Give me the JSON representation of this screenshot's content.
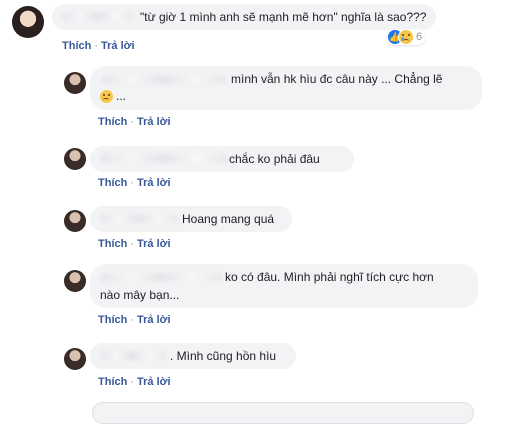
{
  "main_comment": {
    "text": "\"từ giờ 1 mình anh sẽ mạnh mẽ hơn\" nghĩa là sao???",
    "reaction_count": "6",
    "reaction_icons": [
      "like-icon",
      "sad-icon"
    ]
  },
  "actions": {
    "like": "Thích",
    "reply": "Trả lời",
    "separator": "·"
  },
  "replies": [
    {
      "text_line1": "mình vẫn hk hìu đc câu này ... Chẳng lẽ",
      "text_line2": ""
    },
    {
      "text": "chắc ko phải đâu"
    },
    {
      "text": "Hoang mang quá"
    },
    {
      "text_line1": "ko có đâu. Mình phải nghĩ tích cực hơn",
      "text_line2": "nào mây bạn..."
    },
    {
      "text": ". Mình cũng hồn hìu"
    }
  ]
}
